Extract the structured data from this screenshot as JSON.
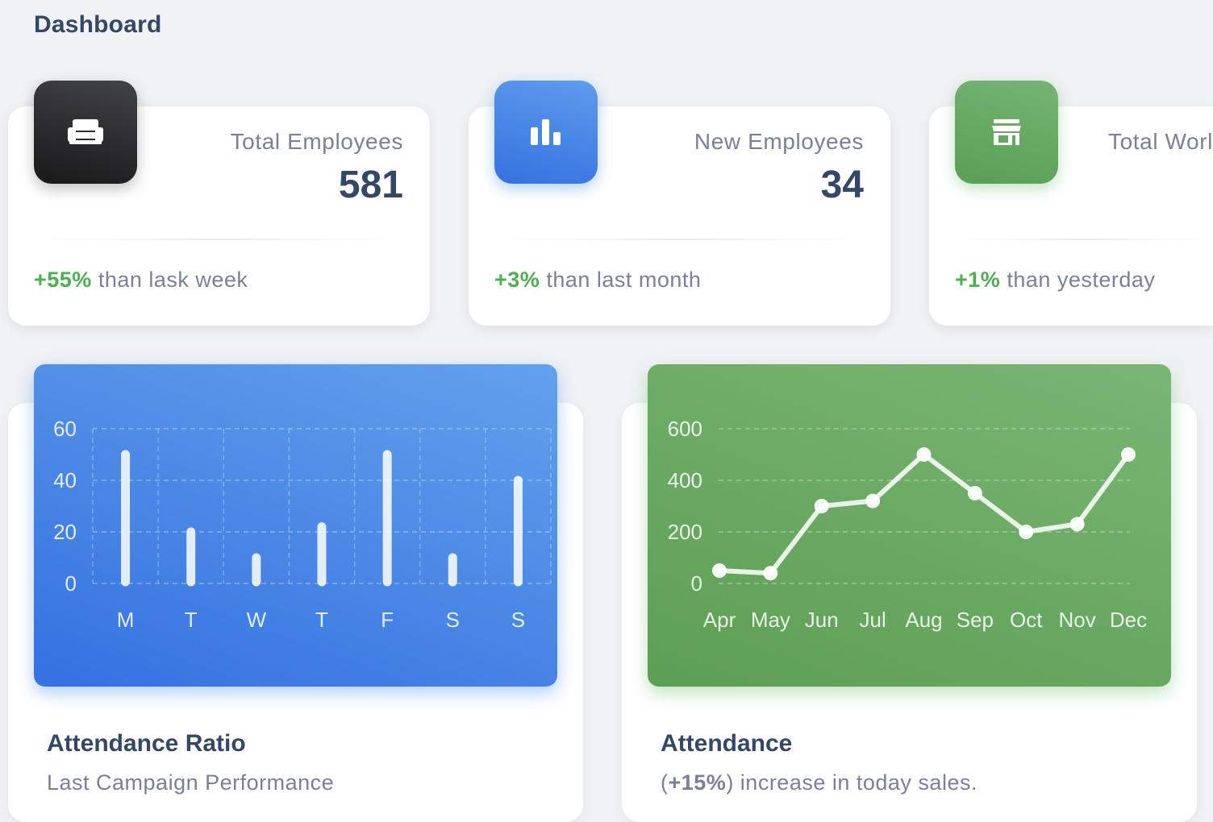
{
  "page": {
    "title": "Dashboard"
  },
  "stats": [
    {
      "label": "Total Employees",
      "value": "581",
      "change": "+55%",
      "change_text": "than lask week",
      "icon": "sofa-icon",
      "color": "dark"
    },
    {
      "label": "New Employees",
      "value": "34",
      "change": "+3%",
      "change_text": "than last month",
      "icon": "bar-chart-icon",
      "color": "blue"
    },
    {
      "label": "Total Worl",
      "value": "",
      "change": "+1%",
      "change_text": "than yesterday",
      "icon": "store-icon",
      "color": "green"
    }
  ],
  "attendance_ratio": {
    "title": "Attendance Ratio",
    "subtitle": "Last Campaign Performance"
  },
  "attendance": {
    "title": "Attendance",
    "subtitle_open": "(",
    "subtitle_strong": "+15%",
    "subtitle_rest": ") increase in today sales."
  },
  "chart_data": [
    {
      "type": "bar",
      "categories": [
        "M",
        "T",
        "W",
        "T",
        "F",
        "S",
        "S"
      ],
      "values": [
        50,
        20,
        10,
        22,
        50,
        10,
        40
      ],
      "yticks": [
        0,
        20,
        40,
        60
      ],
      "ylim": [
        0,
        60
      ],
      "grid": true,
      "color": "#ffffff"
    },
    {
      "type": "line",
      "categories": [
        "Apr",
        "May",
        "Jun",
        "Jul",
        "Aug",
        "Sep",
        "Oct",
        "Nov",
        "Dec"
      ],
      "values": [
        50,
        40,
        300,
        320,
        500,
        350,
        200,
        230,
        500
      ],
      "yticks": [
        0,
        200,
        400,
        600
      ],
      "ylim": [
        0,
        600
      ],
      "grid": true,
      "color": "#ffffff"
    }
  ]
}
